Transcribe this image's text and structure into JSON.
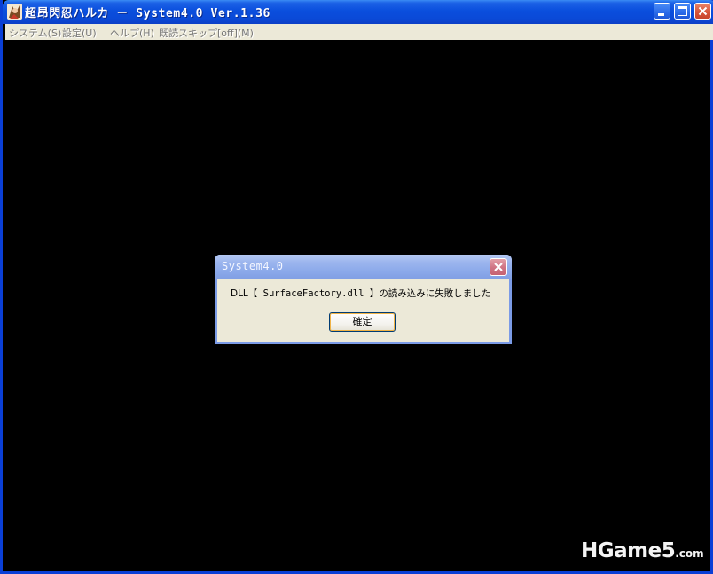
{
  "window": {
    "title": "超昂閃忍ハルカ － System4.0 Ver.1.36",
    "title_color": "#0a4edd"
  },
  "titlebar_buttons": {
    "minimize": "minimize-icon",
    "maximize": "maximize-icon",
    "close": "close-icon"
  },
  "menubar": {
    "items": [
      {
        "label": "システム(S)"
      },
      {
        "label": "設定(U)"
      },
      {
        "label": "ヘルプ(H)"
      },
      {
        "label": "既読スキップ[off](M)"
      }
    ]
  },
  "dialog": {
    "title": "System4.0",
    "message_prefix": "DLL【",
    "message_file": " SurfaceFactory.dll ",
    "message_suffix": "】の読み込みに失敗しました",
    "ok_label": "確定"
  },
  "watermark": {
    "main": "HGame5",
    "suffix": ".com"
  }
}
